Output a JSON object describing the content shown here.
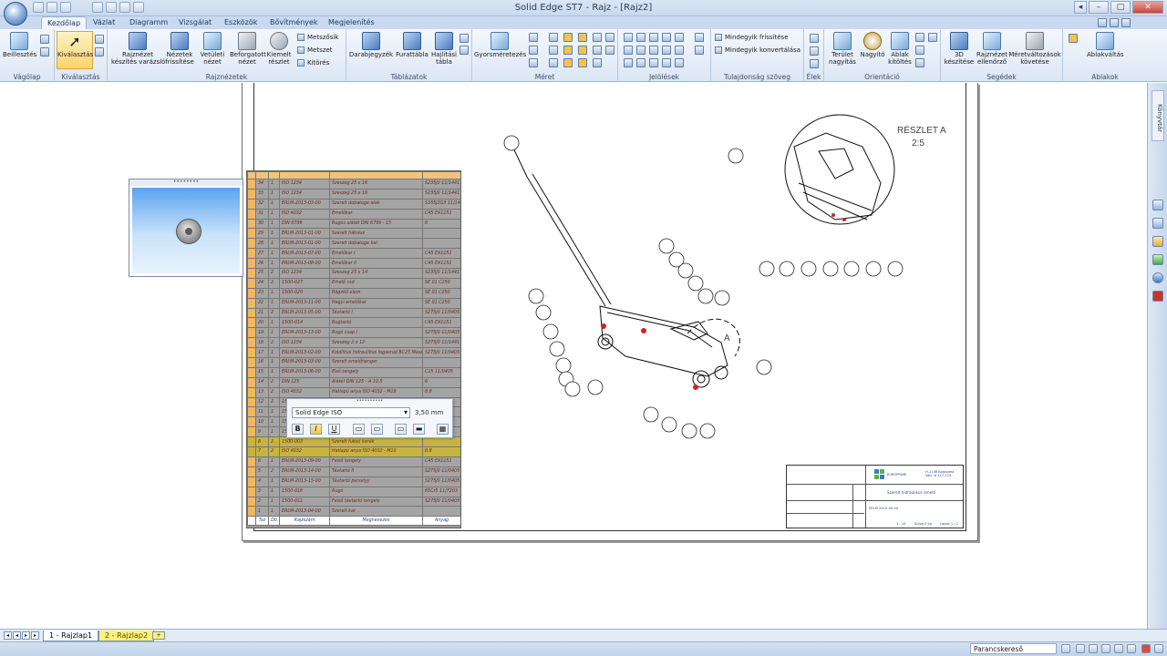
{
  "window": {
    "title": "Solid Edge ST7 - Rajz - [Rajz2]"
  },
  "tabs": [
    "Kezdőlap",
    "Vázlat",
    "Diagramm",
    "Vizsgálat",
    "Eszközök",
    "Bővítmények",
    "Megjelenítés"
  ],
  "ribbon": {
    "groups": [
      "Vágólap",
      "Kiválasztás",
      "Rajznézetek",
      "Táblázatok",
      "Méret",
      "Jelölések",
      "Tulajdonság szöveg",
      "Élek",
      "Orientáció",
      "Segédek",
      "Ablakok"
    ],
    "buttons": {
      "paste": "Beillesztés",
      "select": "Kiválasztás",
      "view_wizard": "Rajznézet\nkészítés varázsló",
      "update_views": "Nézetek\nfrissítése",
      "projected": "Vetületi\nnézet",
      "rotated": "Beforgatott\nnézet",
      "detail": "Kiemelt\nrészlet",
      "section": "Metszősík",
      "cut": "Metszet",
      "breakout": "Kitörés",
      "parts_list": "Darabjegyzék",
      "hole_table": "Furattábla",
      "bend_table": "Hajlítási\ntábla",
      "smart_dim": "Gyorsméretezés",
      "update_all": "Mindegyik frissítése",
      "convert_all": "Mindegyik konvertálása",
      "area_zoom": "Terület\nnagyítás",
      "zoom": "Nagyító",
      "fit": "Ablak\nkitöltés",
      "3d_create": "3D\nkészítése",
      "drawing_check": "Rajznézet\nellenőrző",
      "dim_track": "Méretváltozások\nkövetése",
      "switch_windows": "Ablakváltás"
    }
  },
  "preview": {
    "handle": "••••••••"
  },
  "parts_table": {
    "rows": [
      [
        "34",
        "1",
        "ISO 1234",
        "Szeszeg 25 x 16",
        "S235J0  11/1441"
      ],
      [
        "33",
        "1",
        "ISO 1234",
        "Szeszeg 25 x 16",
        "S235J0  11/1441"
      ],
      [
        "32",
        "1",
        "ERLM-2013-03-00",
        "Szerelt dobatoge alak",
        "S355J2G3  11/1441"
      ],
      [
        "31",
        "1",
        "ISO 4032",
        "Emelőkar",
        "C45  EX1151"
      ],
      [
        "30",
        "1",
        "DIN 6799",
        "Rugós alátét DIN 6799 - 15",
        "6"
      ],
      [
        "29",
        "1",
        "ERLM-2013-01-00",
        "Szerelt hátrész",
        ""
      ],
      [
        "28",
        "1",
        "ERLM-2013-01-00",
        "Szerelt dobatoge bal",
        ""
      ],
      [
        "27",
        "1",
        "ERLM-2013-07-00",
        "Emelőkar I",
        "C45  EX1151"
      ],
      [
        "26",
        "1",
        "ERLM-2013-08-00",
        "Emelőkar II",
        "C45  EX1151"
      ],
      [
        "25",
        "2",
        "ISO 1234",
        "Szeszeg 25 x 14",
        "S235J0  11/1441"
      ],
      [
        "24",
        "2",
        "1500-027",
        "Emelő rúd",
        "SE 01 C250"
      ],
      [
        "23",
        "1",
        "1500-020",
        "Rögzítő elem",
        "SE 01 C250"
      ],
      [
        "22",
        "1",
        "ERLM-2013-11-00",
        "Hegyi emelőkar",
        "SE 01 C250"
      ],
      [
        "21",
        "2",
        "ERLM-2013-05-00",
        "Távtartó I",
        "S275J0  11/0405"
      ],
      [
        "20",
        "1",
        "1500-014",
        "Rugtartó",
        "C45  EX1151"
      ],
      [
        "19",
        "1",
        "ERLM-2013-13-00",
        "Rugó csap I",
        "S275J0  11/0405"
      ],
      [
        "18",
        "2",
        "ISO 1234",
        "Szeszeg 2 x 12",
        "S275J0  11/1441"
      ],
      [
        "17",
        "1",
        "ERLM-2013-02-00",
        "Koldlikus hidraulikus fogasrúd BC25 Maszk",
        "S275J0  11/0405"
      ],
      [
        "16",
        "1",
        "ERLM-2013-03-00",
        "Szerelt emelőhenger",
        ""
      ],
      [
        "15",
        "1",
        "ERLM-2013-06-00",
        "Első tengely",
        "C15  11/0405"
      ],
      [
        "14",
        "2",
        "DIN 125",
        "Alátét DIN 125 - A 10.5",
        "6"
      ],
      [
        "13",
        "2",
        "ISO 4032",
        "Hatlapú anya ISO 4032 - M18",
        "8.8"
      ],
      [
        "12",
        "2",
        "1500",
        "",
        ""
      ],
      [
        "11",
        "1",
        "1500",
        "",
        ""
      ],
      [
        "10",
        "1",
        "1500",
        "",
        ""
      ],
      [
        "9",
        "1",
        "1500",
        "",
        ""
      ],
      [
        "8",
        "2",
        "1500-003",
        "Szerelt hátsó kerék",
        ""
      ],
      [
        "7",
        "2",
        "ISO 4032",
        "Hatlapú anya ISO 4032 - M10",
        "8.8"
      ],
      [
        "6",
        "1",
        "ERLM-2013-09-00",
        "Felső tengely",
        "C45  EX1151"
      ],
      [
        "5",
        "2",
        "ERLM-2013-14-00",
        "Távtartó II",
        "S275J0  11/0405"
      ],
      [
        "4",
        "1",
        "ERLM-2013-15-00",
        "Távtartó perselyy",
        "S275J0  11/0405"
      ],
      [
        "3",
        "1",
        "1500-016",
        "Rugó",
        "65Cr5  11/7203"
      ],
      [
        "2",
        "1",
        "1500-011",
        "Felső távtartó tengely",
        "S275J0  11/0405"
      ],
      [
        "1",
        "1",
        "ERLM-2013-04-00",
        "Szerelt kar",
        ""
      ]
    ],
    "footer": [
      "Tsz",
      "Db",
      "Rajzszám",
      "Megnevezés",
      "Anyag"
    ]
  },
  "format_toolbar": {
    "font": "Solid Edge ISO",
    "size": "3,50 mm",
    "bold": "B",
    "italic": "I",
    "underline": "U"
  },
  "drawing": {
    "detail_label": "RÉSZLET A",
    "detail_scale": "2:5",
    "section_letter": "A"
  },
  "title_block": {
    "company": "EUROPRIME",
    "address": "H-1138 Budapest\nVáci út 117-119.",
    "title": "Szerelt hidraulikus emelő",
    "drawing_no": "ERLM-2015-00-00",
    "scale": "1 : 10",
    "sheet": "Lapok 1 / 2",
    "mass": "Súlyg   0 kg"
  },
  "right_panel": {
    "library": "Könyvtár"
  },
  "sheet_tabs": [
    "1 - Rajzlap1",
    "2 - Rajzlap2"
  ],
  "status": {
    "command_finder": "Parancskereső"
  }
}
